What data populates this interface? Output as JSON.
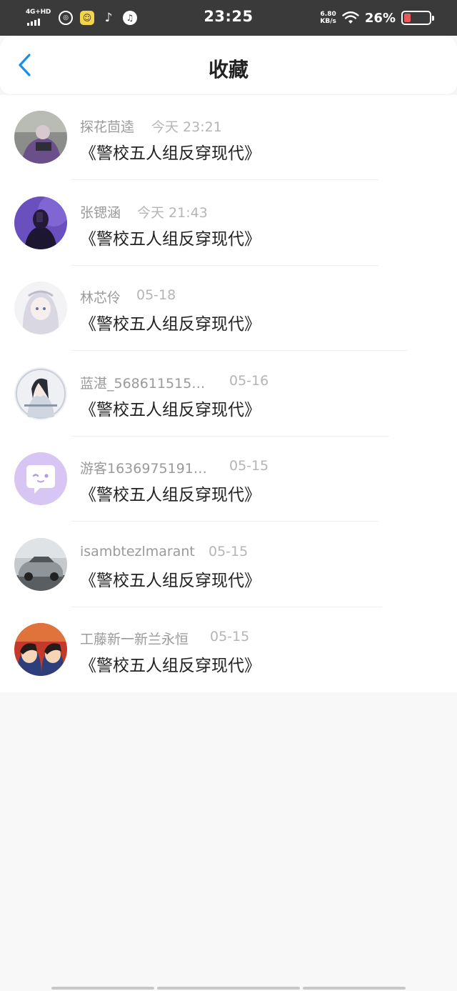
{
  "status_bar": {
    "network": "4G+HD",
    "time": "23:25",
    "speed_value": "6.80",
    "speed_unit": "KB/s",
    "battery_percent": "26%",
    "battery_level": 0.26
  },
  "header": {
    "title": "收藏",
    "back_icon": "chevron-left-icon",
    "accent_color": "#1a8ee6"
  },
  "favorites": [
    {
      "user": "探花茴逵",
      "time": "今天 23:21",
      "title": "《警校五人组反穿现代》"
    },
    {
      "user": "张锶涵",
      "time": "今天 21:43",
      "title": "《警校五人组反穿现代》"
    },
    {
      "user": "林芯伶",
      "time": "05-18",
      "title": "《警校五人组反穿现代》"
    },
    {
      "user": "蓝湛_568611515…",
      "time": "05-16",
      "title": "《警校五人组反穿现代》"
    },
    {
      "user": "游客1636975191…",
      "time": "05-15",
      "title": "《警校五人组反穿现代》"
    },
    {
      "user": "isambtezlmarant",
      "time": "05-15",
      "title": "《警校五人组反穿现代》"
    },
    {
      "user": "工藤新一新兰永恒",
      "time": "05-15",
      "title": "《警校五人组反穿现代》"
    }
  ]
}
